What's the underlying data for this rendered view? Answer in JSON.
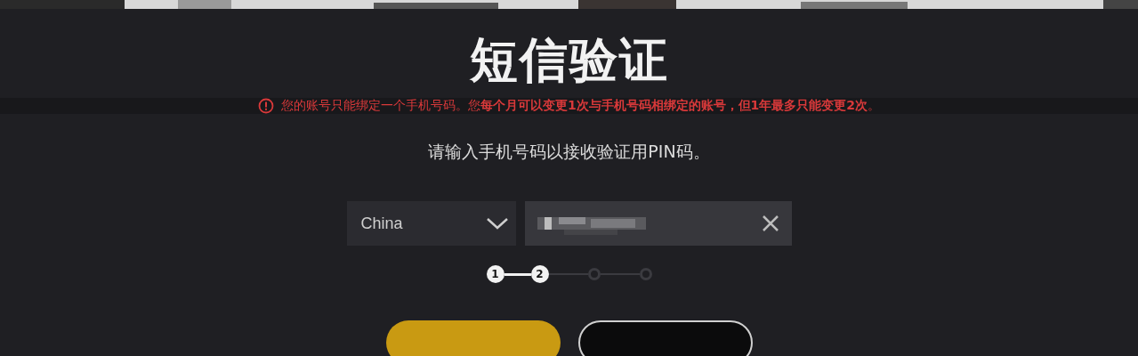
{
  "title": "短信验证",
  "warning": {
    "text": "您的账号只能绑定一个手机号码。您**每个月可以变更1次与手机号码相绑定的账号，但1年最多只能变更2次**。"
  },
  "instruction": "请输入手机号码以接收验证用PIN码。",
  "country_select": {
    "value": "China"
  },
  "phone_field": {
    "blurred": true
  },
  "steps": [
    {
      "label": "1",
      "done": true
    },
    {
      "label": "2",
      "done": true
    },
    {
      "done": false
    },
    {
      "done": false
    }
  ],
  "buttons": [
    {
      "kind": "primary"
    },
    {
      "kind": "secondary"
    }
  ]
}
